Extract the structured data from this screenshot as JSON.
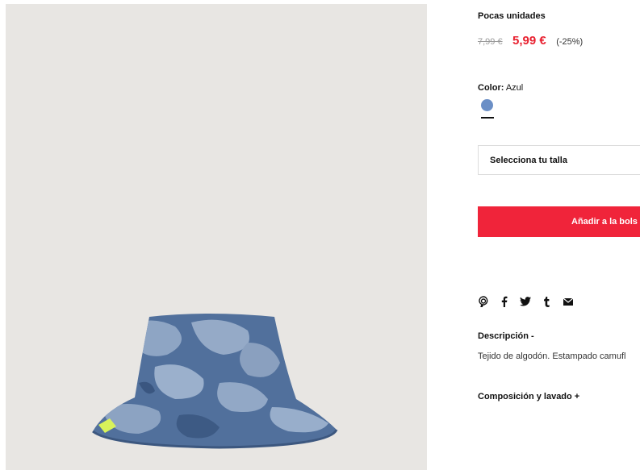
{
  "product": {
    "stock_status": "Pocas unidades",
    "old_price": "7,99 €",
    "new_price": "5,99 €",
    "discount": "(-25%)",
    "color_label": "Color:",
    "color_value": "Azul",
    "swatch_color": "#6b8fc6",
    "size_select_label": "Selecciona tu talla",
    "add_to_bag_label": "Añadir a la bols",
    "image_icon": "bucket-hat-camouflage"
  },
  "share": {
    "icons": [
      "pinterest-icon",
      "facebook-icon",
      "twitter-icon",
      "tumblr-icon",
      "email-icon"
    ]
  },
  "description": {
    "title": "Descripción  -",
    "text": "Tejido de algodón. Estampado camufl"
  },
  "composition": {
    "title": "Composición y lavado  +"
  },
  "colors": {
    "accent_red": "#f0243a",
    "price_red": "#e8202f",
    "image_background": "#e8e6e3"
  }
}
